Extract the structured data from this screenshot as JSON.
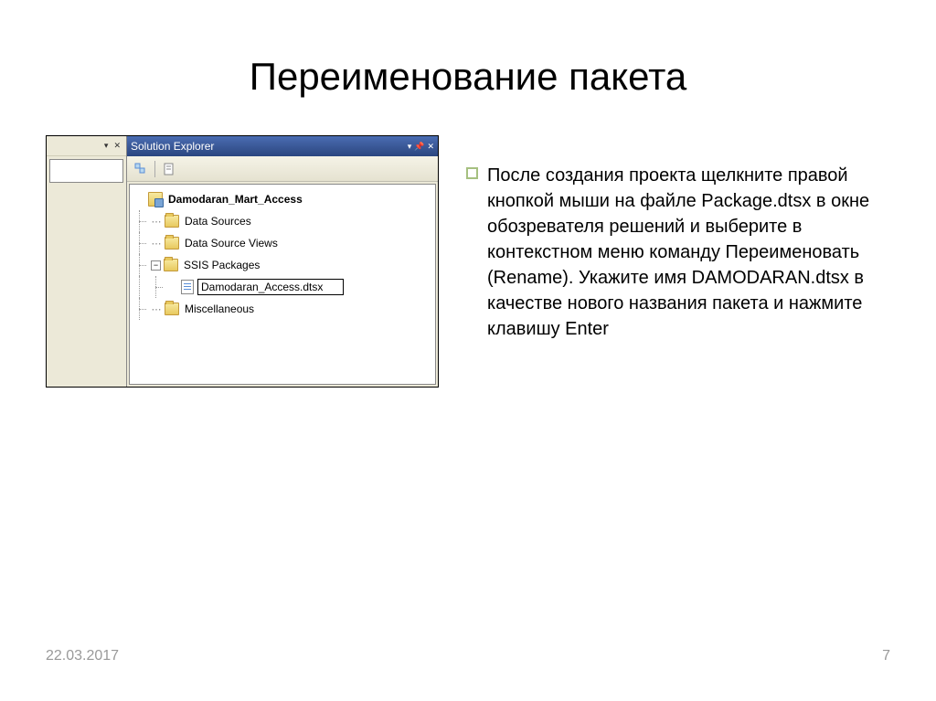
{
  "title": "Переименование пакета",
  "body_text": "После создания проекта щелкните правой кнопкой мыши на файле Package.dtsx в окне обозревателя решений и выберите в контекстном меню команду Переименовать (Rename). Укажите имя DAMODARAN.dtsx в качестве нового названия пакета и нажмите клавишу Enter",
  "footer": {
    "date": "22.03.2017",
    "page": "7"
  },
  "screenshot": {
    "titlebar": "Solution Explorer",
    "tree": {
      "project": "Damodaran_Mart_Access",
      "nodes": {
        "data_sources": "Data Sources",
        "data_source_views": "Data Source Views",
        "ssis_packages": "SSIS Packages",
        "miscellaneous": "Miscellaneous"
      },
      "rename_value": "Damodaran_Access.dtsx"
    }
  }
}
